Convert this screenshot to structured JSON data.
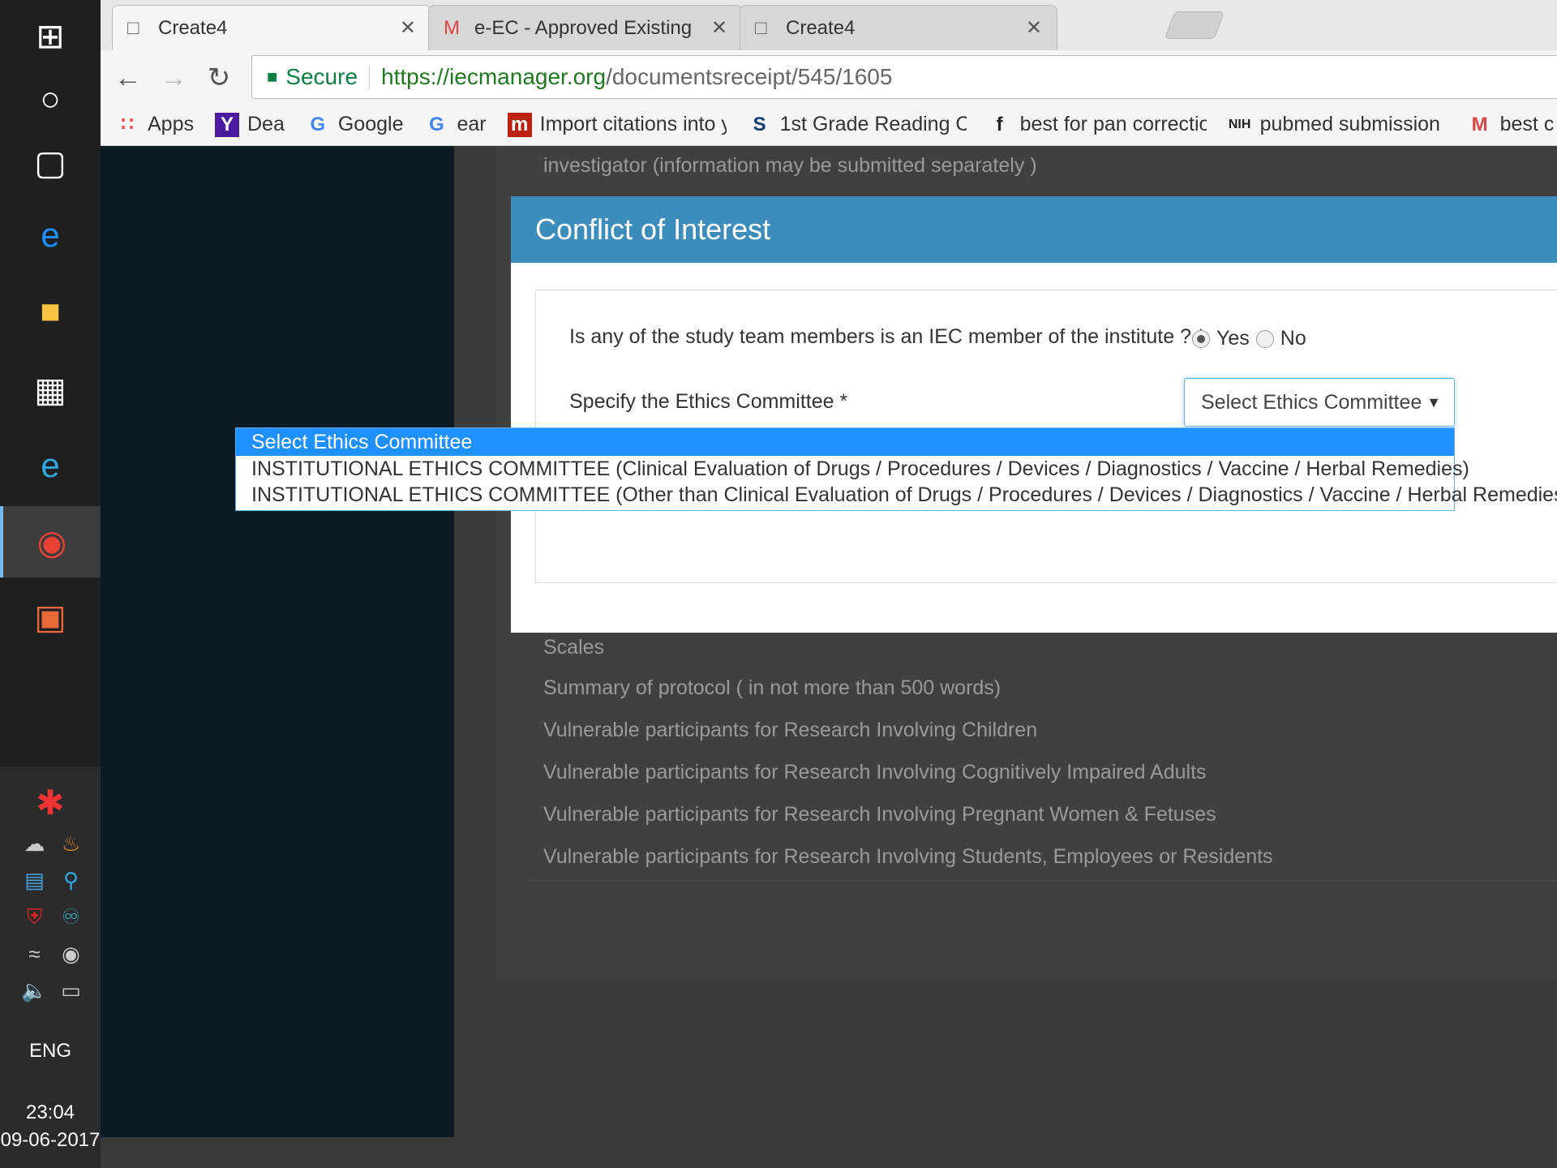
{
  "taskbar": {
    "icons": [
      "windows-start-icon",
      "cortana-icon",
      "task-view-icon",
      "edge-icon",
      "file-explorer-icon",
      "store-icon",
      "internet-explorer-icon",
      "chrome-icon",
      "powerpoint-icon",
      "security-alert-icon"
    ],
    "tray": {
      "language": "ENG",
      "time": "23:04",
      "date": "09-06-2017"
    }
  },
  "tabs": [
    {
      "label": "Create4",
      "icon": "page-icon",
      "active": true
    },
    {
      "label": "e-EC - Approved Existing",
      "icon": "gmail-icon",
      "active": false
    },
    {
      "label": "Create4",
      "icon": "page-icon",
      "active": false
    }
  ],
  "address_bar": {
    "secure_label": "Secure",
    "host": "https://iecmanager.org",
    "path": "/documentsreceipt/545/1605"
  },
  "bookmarks": [
    {
      "label": "Apps",
      "icon": "apps-grid-icon"
    },
    {
      "label": "Dea",
      "icon": "yahoo-icon"
    },
    {
      "label": "Google",
      "icon": "google-icon"
    },
    {
      "label": "ear",
      "icon": "google-icon"
    },
    {
      "label": "Import citations into y",
      "icon": "mendeley-icon"
    },
    {
      "label": "1st Grade Reading Co",
      "icon": "s-icon"
    },
    {
      "label": "best for pan correctio",
      "icon": "f-icon"
    },
    {
      "label": "pubmed submission N",
      "icon": "nih-icon"
    },
    {
      "label": "best c",
      "icon": "gmail-icon"
    }
  ],
  "background_page": {
    "top_text": "investigator (information may be submitted separately )",
    "rows": [
      "Scales",
      "Summary of protocol ( in not more than 500 words)",
      "Vulnerable participants for Research Involving Children",
      "Vulnerable participants for Research Involving Cognitively Impaired Adults",
      "Vulnerable participants for Research Involving Pregnant Women & Fetuses",
      "Vulnerable participants for Research Involving Students, Employees or Residents"
    ]
  },
  "modal": {
    "title": "Conflict of Interest",
    "question": "Is any of the study team members is an IEC member of the institute ? *",
    "radio_yes": "Yes",
    "radio_no": "No",
    "selected_radio": "Yes",
    "committee_label": "Specify the Ethics Committee *",
    "select_value": "Select Ethics Committee",
    "options": [
      "Select Ethics Committee",
      "INSTITUTIONAL ETHICS COMMITTEE (Clinical Evaluation of Drugs / Procedures / Devices / Diagnostics / Vaccine / Herbal Remedies)",
      "INSTITUTIONAL ETHICS COMMITTEE (Other than Clinical Evaluation of Drugs / Procedures / Devices / Diagnostics / Vaccine / Herbal Remedies)"
    ]
  },
  "colors": {
    "modal_header": "#3c8dbc",
    "option_highlight": "#1e90ff",
    "secure_green": "#0b8043"
  }
}
